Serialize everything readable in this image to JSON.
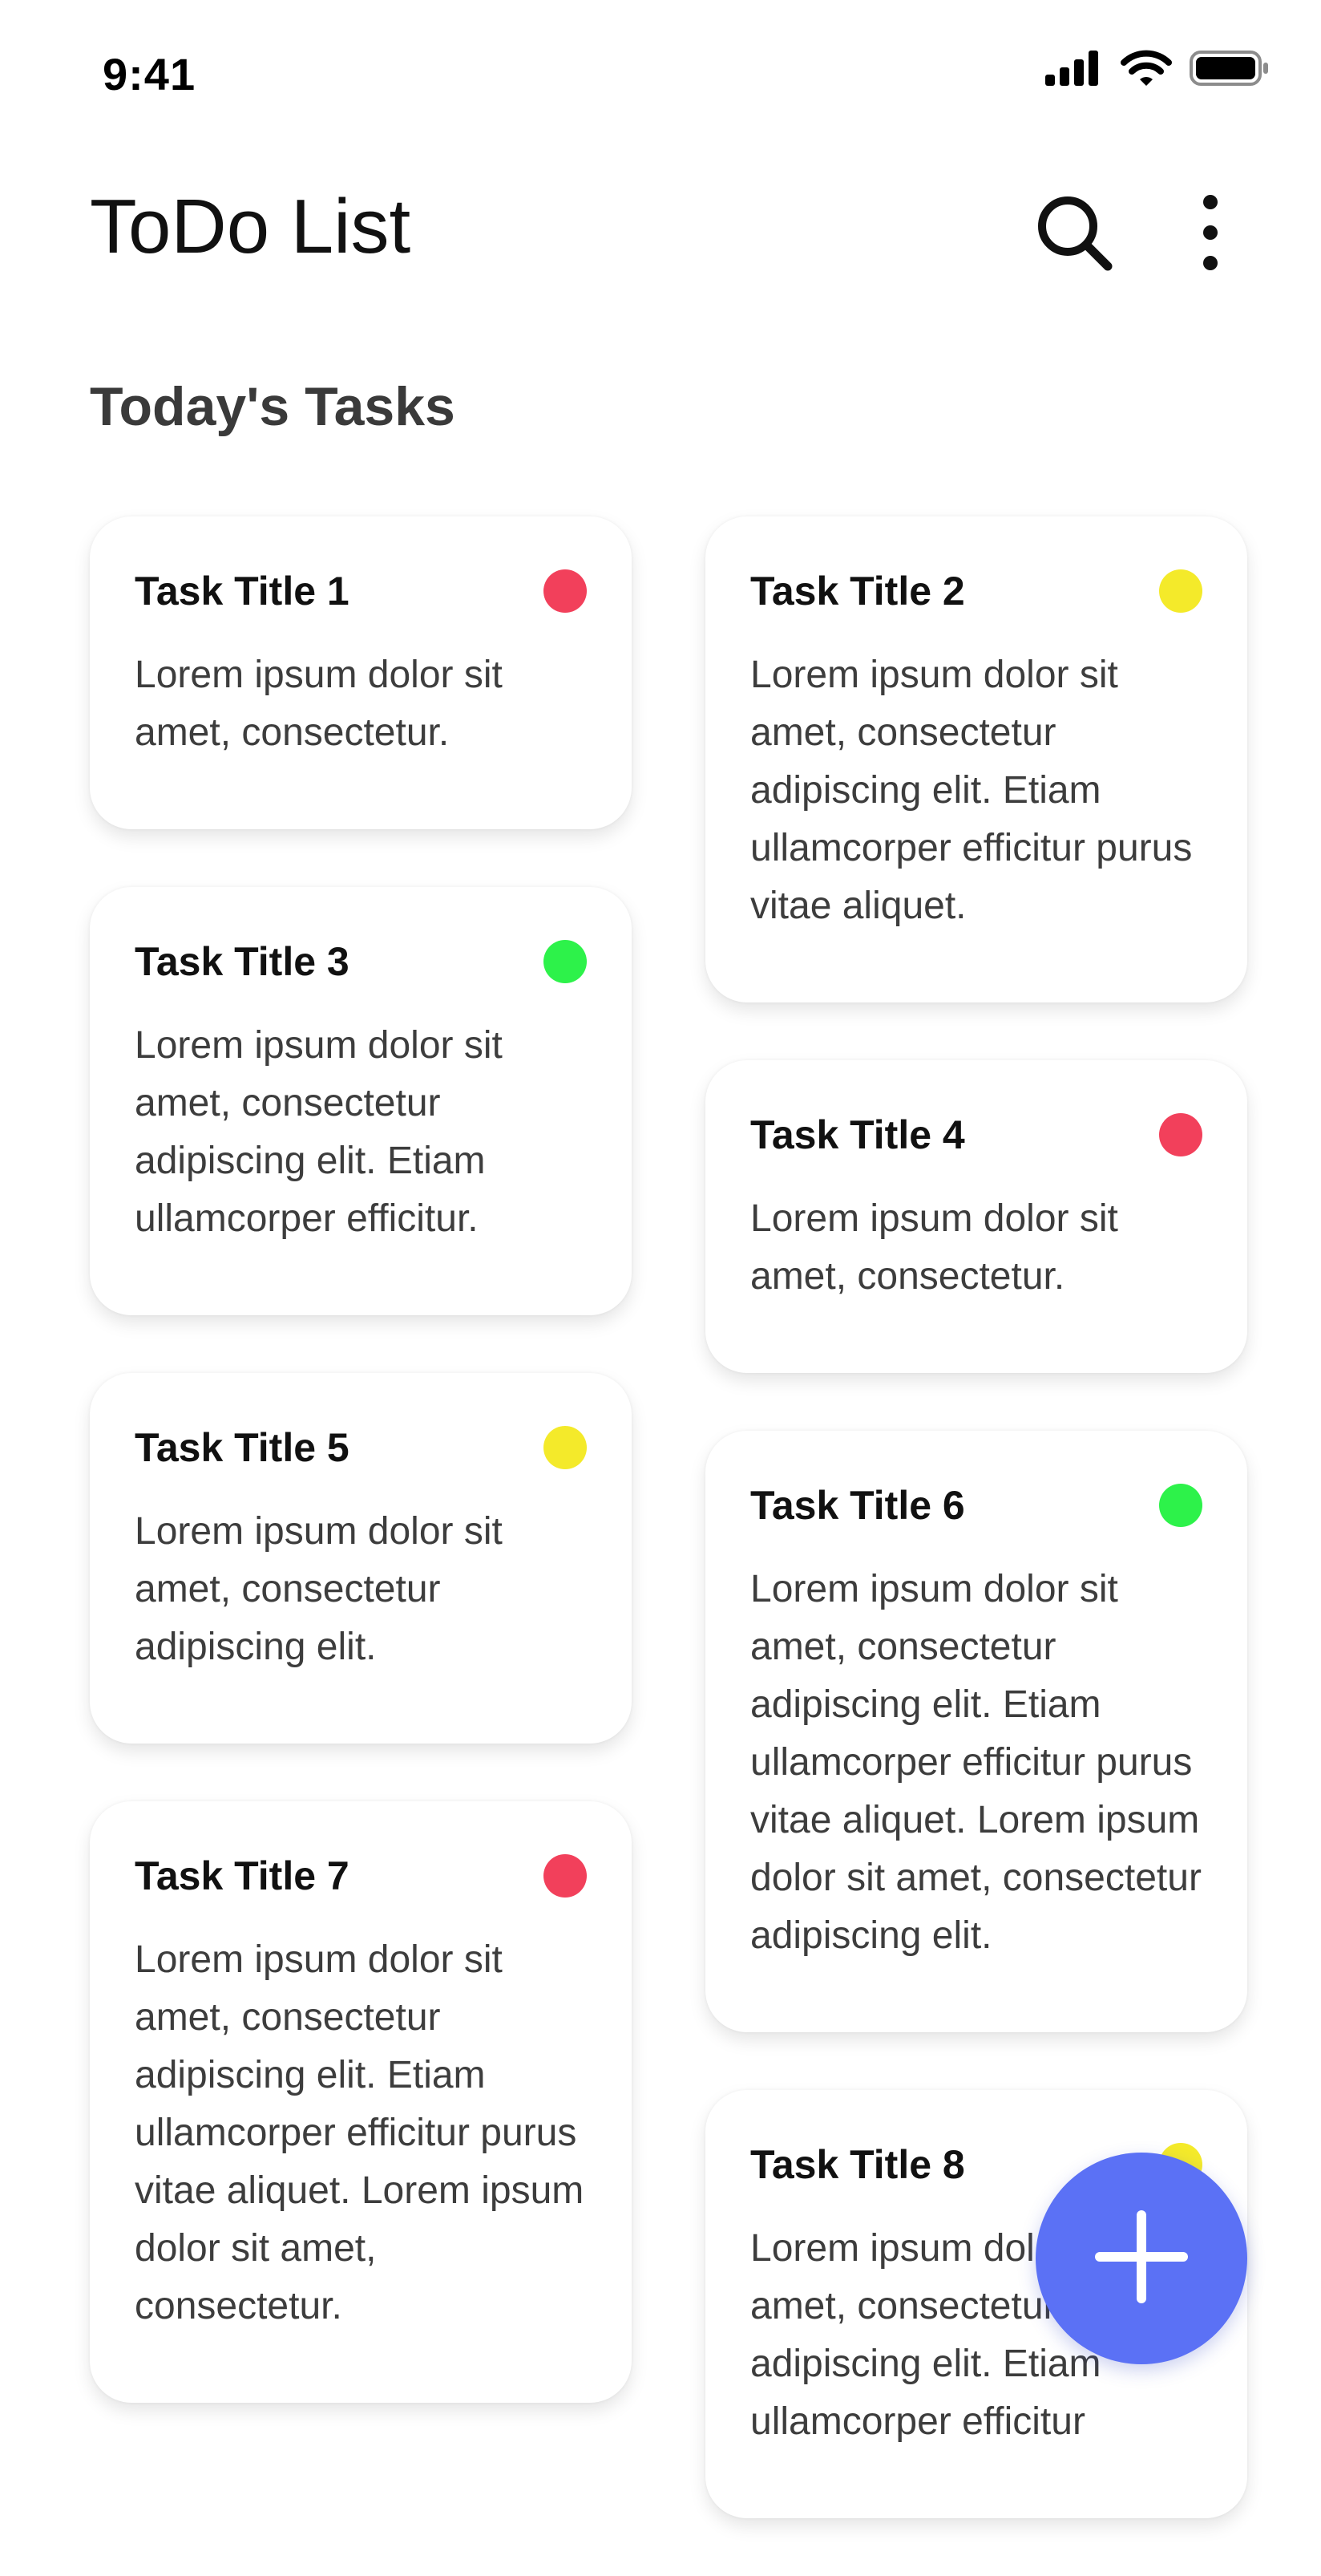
{
  "status_bar": {
    "time": "9:41",
    "icons": [
      "signal-icon",
      "wifi-icon",
      "battery-icon"
    ]
  },
  "header": {
    "title": "ToDo List",
    "icons": [
      "search-icon",
      "more-vertical-icon"
    ]
  },
  "section": {
    "title": "Today's Tasks"
  },
  "colors": {
    "priority_high": "#F2405B",
    "priority_medium": "#F4EA2A",
    "priority_low": "#2DF24A",
    "fab": "#5B71F5"
  },
  "tasks": {
    "t1": {
      "title": "Task Title 1",
      "body": "Lorem ipsum dolor sit amet, consectetur.",
      "status": "priority_high"
    },
    "t2": {
      "title": "Task Title 2",
      "body": "Lorem ipsum dolor sit amet, consectetur adipiscing elit. Etiam ullamcorper efficitur purus vitae aliquet.",
      "status": "priority_medium"
    },
    "t3": {
      "title": "Task Title 3",
      "body": "Lorem ipsum dolor sit amet, consectetur adipiscing elit. Etiam ullamcorper efficitur.",
      "status": "priority_low"
    },
    "t4": {
      "title": "Task Title 4",
      "body": "Lorem ipsum dolor sit amet, consectetur.",
      "status": "priority_high"
    },
    "t5": {
      "title": "Task Title 5",
      "body": "Lorem ipsum dolor sit amet, consectetur adipiscing elit.",
      "status": "priority_medium"
    },
    "t6": {
      "title": "Task Title 6",
      "body": "Lorem ipsum dolor sit amet, consectetur adipiscing elit. Etiam ullamcorper efficitur purus vitae aliquet. Lorem ipsum dolor sit amet, consectetur adipiscing elit.",
      "status": "priority_low"
    },
    "t7": {
      "title": "Task Title 7",
      "body": "Lorem ipsum dolor sit amet, consectetur adipiscing elit. Etiam ullamcorper efficitur purus vitae aliquet. Lorem ipsum dolor sit amet, consectetur.",
      "status": "priority_high"
    },
    "t8": {
      "title": "Task Title 8",
      "body": "Lorem ipsum dolor sit amet, consectetur adipiscing elit. Etiam ullamcorper efficitur",
      "status": "priority_medium"
    }
  },
  "fab": {
    "icon": "plus-icon"
  }
}
